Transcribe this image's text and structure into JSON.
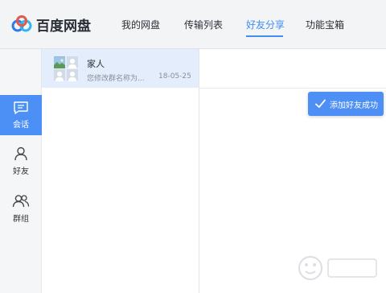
{
  "app": {
    "logo_text": "百度网盘"
  },
  "nav": {
    "tabs": [
      {
        "label": "我的网盘"
      },
      {
        "label": "传输列表"
      },
      {
        "label": "好友分享",
        "active": true
      },
      {
        "label": "功能宝箱"
      }
    ]
  },
  "rail": {
    "items": [
      {
        "label": "会话",
        "icon": "chat-icon",
        "active": true
      },
      {
        "label": "好友",
        "icon": "user-icon"
      },
      {
        "label": "群组",
        "icon": "group-icon"
      }
    ]
  },
  "conversations": [
    {
      "name": "家人",
      "preview": "您修改群名称为...",
      "date": "18-05-25",
      "selected": true
    }
  ],
  "toast": {
    "text": "添加好友成功",
    "icon": "check-icon"
  },
  "colors": {
    "accent": "#4d8ff4",
    "nav_active": "#3e8ef7",
    "selected_row": "#e4edfb"
  }
}
